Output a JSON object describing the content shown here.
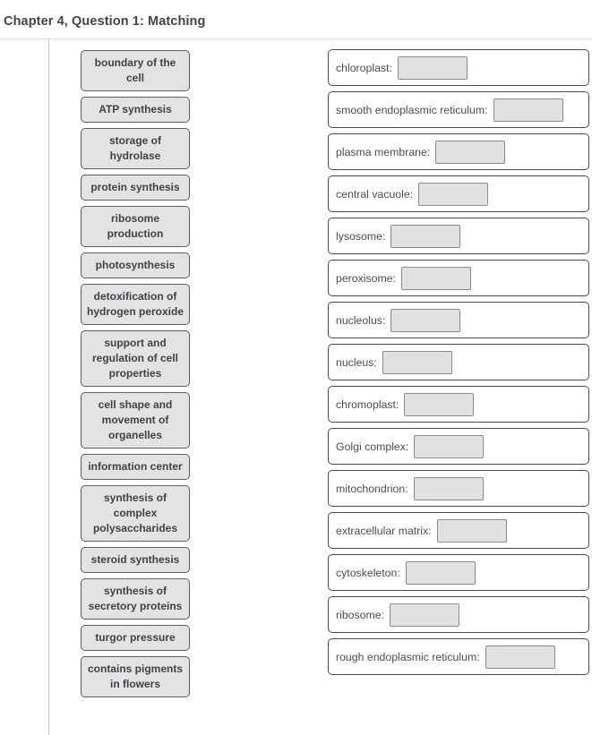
{
  "page": {
    "title": "Chapter 4, Question 1: Matching"
  },
  "terms": {
    "items": [
      {
        "label": "boundary of the cell"
      },
      {
        "label": "ATP synthesis"
      },
      {
        "label": "storage of hydrolase"
      },
      {
        "label": "protein synthesis"
      },
      {
        "label": "ribosome production"
      },
      {
        "label": "photosynthesis"
      },
      {
        "label": "detoxification of hydrogen peroxide"
      },
      {
        "label": "support and regulation of cell properties"
      },
      {
        "label": "cell shape and movement of organelles"
      },
      {
        "label": "information center"
      },
      {
        "label": "synthesis of complex polysaccharides"
      },
      {
        "label": "steroid synthesis"
      },
      {
        "label": "synthesis of secretory proteins"
      },
      {
        "label": "turgor pressure"
      },
      {
        "label": "contains pigments in flowers"
      }
    ]
  },
  "answers": {
    "items": [
      {
        "label": "chloroplast:",
        "value": ""
      },
      {
        "label": "smooth endoplasmic reticulum:",
        "value": ""
      },
      {
        "label": "plasma membrane:",
        "value": ""
      },
      {
        "label": "central vacuole:",
        "value": ""
      },
      {
        "label": "lysosome:",
        "value": ""
      },
      {
        "label": "peroxisome:",
        "value": ""
      },
      {
        "label": "nucleolus:",
        "value": ""
      },
      {
        "label": "nucleus:",
        "value": ""
      },
      {
        "label": "chromoplast:",
        "value": ""
      },
      {
        "label": "Golgi complex:",
        "value": ""
      },
      {
        "label": "mitochondrion:",
        "value": ""
      },
      {
        "label": "extracellular matrix:",
        "value": ""
      },
      {
        "label": "cytoskeleton:",
        "value": ""
      },
      {
        "label": "ribosome:",
        "value": ""
      },
      {
        "label": "rough endoplasmic reticulum:",
        "value": ""
      }
    ]
  },
  "colors": {
    "tile_fill": "#e3e3e3",
    "tile_border": "#5c5c66",
    "row_border": "#4a4a53",
    "drop_fill": "#e1e1e1",
    "drop_border": "#8a8a94",
    "text": "#41414a",
    "divider": "#c9c9c9"
  }
}
